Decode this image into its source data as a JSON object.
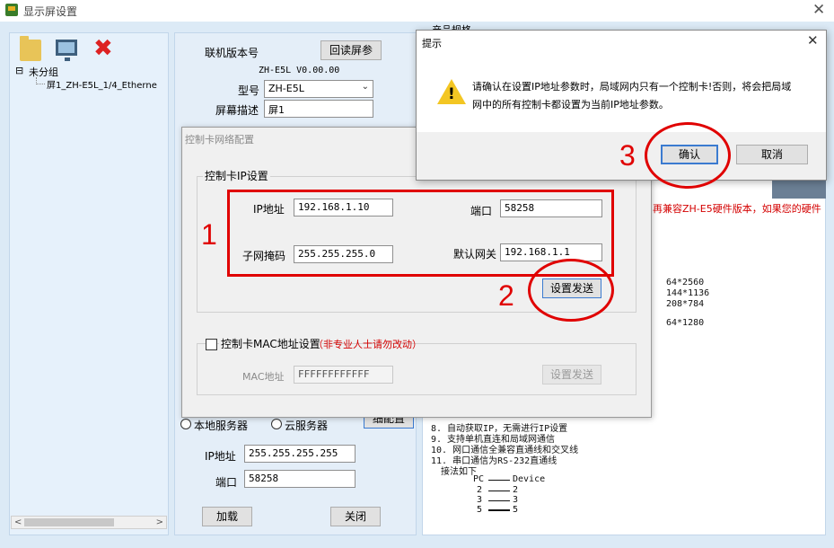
{
  "window": {
    "title": "显示屏设置"
  },
  "toolbar": {
    "icons": [
      "folder-icon",
      "monitor-icon",
      "delete-icon"
    ]
  },
  "tree": {
    "root": "未分组",
    "child": "屏1_ZH-E5L_1/4_Etherne"
  },
  "center": {
    "firmware_label": "联机版本号",
    "readback_button": "回读屏参",
    "firmware_value": "ZH-E5L V0.00.00",
    "model_label": "型号",
    "model_value": "ZH-E5L",
    "screen_desc_label": "屏幕描述",
    "screen_desc_value": "屏1",
    "local_server": "本地服务器",
    "cloud_server": "云服务器",
    "partial_button": "细配置",
    "ip_label": "IP地址",
    "ip_value": "255.255.255.255",
    "port_label": "端口",
    "port_value": "58258",
    "load_button": "加载",
    "close_button": "关闭"
  },
  "right": {
    "spec_header": "产品规格",
    "red_notice": "再兼容ZH-E5硬件版本，如果您的硬件",
    "sizes": [
      "64*2560",
      "144*1136",
      "208*784",
      "64*1280"
    ],
    "lines": [
      "8. 自动获取IP，无需进行IP设置",
      "9. 支持单机直连和局域网通信",
      "10. 网口通信全兼容直通线和交叉线",
      "11. 串口通信为RS-232直通线",
      "接法如下"
    ],
    "wiring": {
      "header_pc": "PC",
      "header_device": "Device",
      "pins": [
        [
          "2",
          "2"
        ],
        [
          "3",
          "3"
        ],
        [
          "5",
          "5"
        ]
      ]
    }
  },
  "netdlg": {
    "title": "控制卡网络配置",
    "ip_group_title": "控制卡IP设置",
    "ip_label": "IP地址",
    "ip_value": "192.168.1.10",
    "port_label": "端口",
    "port_value": "58258",
    "mask_label": "子网掩码",
    "mask_value": "255.255.255.0",
    "gateway_label": "默认网关",
    "gateway_value": "192.168.1.1",
    "send_button": "设置发送",
    "mac_checkbox_label": "控制卡MAC地址设置",
    "mac_warning": "（非专业人士请勿改动）",
    "mac_label": "MAC地址",
    "mac_value": "FFFFFFFFFFFF",
    "mac_send_button": "设置发送"
  },
  "prompt": {
    "title": "提示",
    "message": "请确认在设置IP地址参数时，局域网内只有一个控制卡!否则，将会把局域网中的所有控制卡都设置为当前IP地址参数。",
    "ok_button": "确认",
    "cancel_button": "取消"
  },
  "annotations": {
    "step1": "1",
    "step2": "2",
    "step3": "3"
  },
  "colors": {
    "annotation": "#e00000",
    "background": "#dceaf6",
    "warning": "#f3c623"
  }
}
